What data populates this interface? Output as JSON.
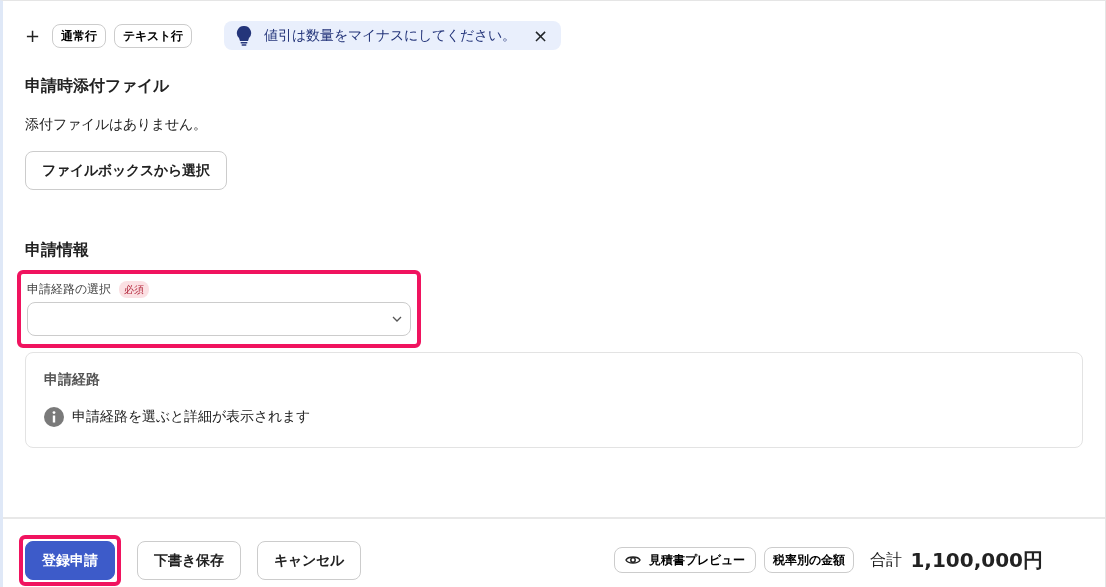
{
  "add_row": {
    "plus": "+",
    "buttons": [
      "通常行",
      "テキスト行"
    ]
  },
  "tip": {
    "text": "値引は数量をマイナスにしてください。",
    "close": "×"
  },
  "attachments": {
    "heading": "申請時添付ファイル",
    "empty_text": "添付ファイルはありません。",
    "button": "ファイルボックスから選択"
  },
  "application": {
    "heading": "申請情報",
    "route_field": {
      "label": "申請経路の選択",
      "required_badge": "必須",
      "highlighted": true
    },
    "route_panel": {
      "title": "申請経路",
      "info": "申請経路を選ぶと詳細が表示されます"
    }
  },
  "footer": {
    "buttons": [
      {
        "label": "登録申請",
        "kind": "primary",
        "highlighted": true
      },
      {
        "label": "下書き保存",
        "kind": "outline",
        "highlighted": false
      },
      {
        "label": "キャンセル",
        "kind": "outline",
        "highlighted": false
      }
    ],
    "preview_button": "見積書プレビュー",
    "tax_button": "税率別の金額",
    "total_label": "合計",
    "total_value": "1,100,000円"
  }
}
